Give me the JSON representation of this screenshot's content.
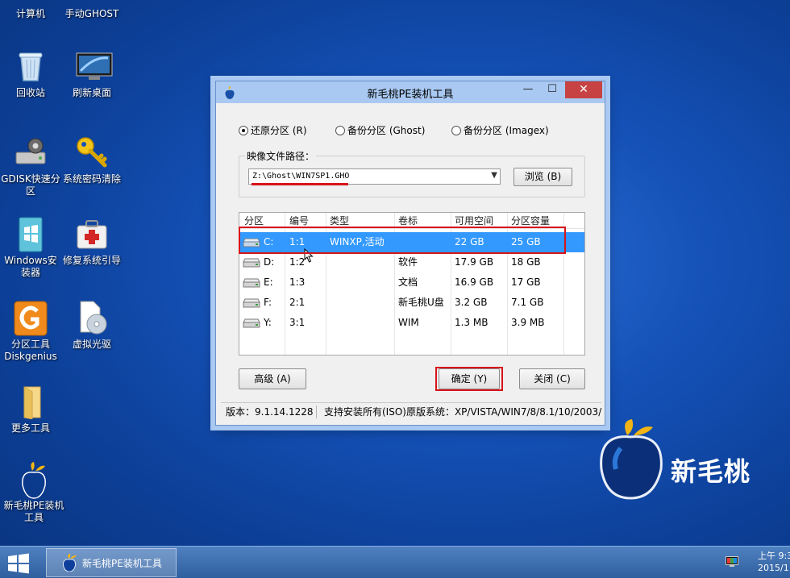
{
  "desktop": {
    "icons": [
      {
        "label": "计算机"
      },
      {
        "label": "手动GHOST"
      },
      {
        "label": "回收站"
      },
      {
        "label": "刷新桌面"
      },
      {
        "label": "GDISK快速分区"
      },
      {
        "label": "系统密码清除"
      },
      {
        "label": "Windows安装器"
      },
      {
        "label": "修复系统引导"
      },
      {
        "label": "分区工具Diskgenius"
      },
      {
        "label": "虚拟光驱"
      },
      {
        "label": "更多工具"
      },
      {
        "label": "新毛桃PE装机工具"
      }
    ],
    "brand_text": "新毛桃"
  },
  "dialog": {
    "title": "新毛桃PE装机工具",
    "title_buttons": {
      "minimize": "—",
      "maximize": "☐",
      "close": "✕"
    },
    "radios": [
      {
        "label": "还原分区 (R)",
        "checked": true
      },
      {
        "label": "备份分区 (Ghost)",
        "checked": false
      },
      {
        "label": "备份分区 (Imagex)",
        "checked": false
      }
    ],
    "image_path_label": "映像文件路径：",
    "image_path_value": "Z:\\Ghost\\WIN7SP1.GHO",
    "browse_label": "浏览 (B)",
    "table": {
      "headers": [
        "分区",
        "编号",
        "类型",
        "卷标",
        "可用空间",
        "分区容量"
      ],
      "rows": [
        {
          "part": "C:",
          "num": "1:1",
          "type": "WINXP,活动",
          "label": "",
          "free": "22 GB",
          "cap": "25 GB",
          "selected": true
        },
        {
          "part": "D:",
          "num": "1:2",
          "type": "",
          "label": "软件",
          "free": "17.9 GB",
          "cap": "18 GB",
          "selected": false
        },
        {
          "part": "E:",
          "num": "1:3",
          "type": "",
          "label": "文档",
          "free": "16.9 GB",
          "cap": "17 GB",
          "selected": false
        },
        {
          "part": "F:",
          "num": "2:1",
          "type": "",
          "label": "新毛桃U盘",
          "free": "3.2 GB",
          "cap": "7.1 GB",
          "selected": false
        },
        {
          "part": "Y:",
          "num": "3:1",
          "type": "",
          "label": "WIM",
          "free": "1.3 MB",
          "cap": "3.9 MB",
          "selected": false
        }
      ]
    },
    "advanced_label": "高级 (A)",
    "ok_label": "确定 (Y)",
    "close_label": "关闭 (C)",
    "status_version": "版本：9.1.14.1228",
    "status_support": "支持安装所有(ISO)原版系统：XP/VISTA/WIN7/8/8.1/10/2003/"
  },
  "taskbar": {
    "task_label": "新毛桃PE装机工具",
    "clock_time": "上午 9:3",
    "clock_date": "2015/1"
  },
  "colors": {
    "selection": "#3399ff",
    "highlight_box": "#d8131b",
    "close_button": "#c74343"
  }
}
